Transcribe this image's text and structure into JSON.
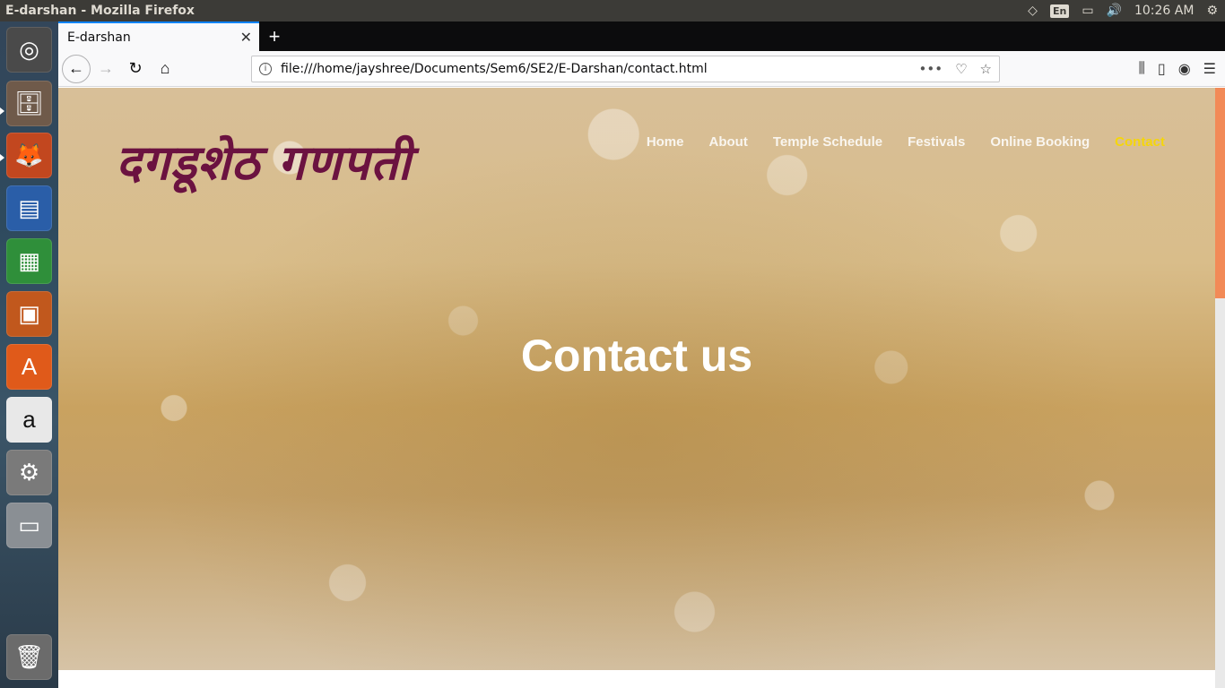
{
  "os": {
    "window_title": "E-darshan - Mozilla Firefox",
    "lang": "En",
    "time": "10:26 AM"
  },
  "launcher": {
    "items": [
      {
        "name": "ubuntu-dash-icon",
        "glyph": "◎",
        "bg": "#4a4a4a"
      },
      {
        "name": "files-icon",
        "glyph": "🗄",
        "bg": "#6f5a4a"
      },
      {
        "name": "firefox-icon",
        "glyph": "🦊",
        "bg": "#c2471f"
      },
      {
        "name": "writer-icon",
        "glyph": "▤",
        "bg": "#2a5ea8"
      },
      {
        "name": "calc-icon",
        "glyph": "▦",
        "bg": "#2f8f3a"
      },
      {
        "name": "impress-icon",
        "glyph": "▣",
        "bg": "#c1581d"
      },
      {
        "name": "software-center-icon",
        "glyph": "A",
        "bg": "#e05a1a"
      },
      {
        "name": "amazon-icon",
        "glyph": "a",
        "bg": "#e8e8e8"
      },
      {
        "name": "settings-icon",
        "glyph": "⚙",
        "bg": "#7a7a7a"
      },
      {
        "name": "disk-icon",
        "glyph": "▭",
        "bg": "#8a8f94"
      },
      {
        "name": "trash-icon",
        "glyph": "🗑",
        "bg": "#6b6b6b"
      }
    ]
  },
  "browser": {
    "tab_title": "E-darshan",
    "url": "file:///home/jayshree/Documents/Sem6/SE2/E-Darshan/contact.html"
  },
  "site": {
    "logo_text": "दगडूशेठ गणपती",
    "nav": {
      "home": "Home",
      "about": "About",
      "schedule": "Temple Schedule",
      "festivals": "Festivals",
      "booking": "Online Booking",
      "contact": "Contact"
    },
    "hero_title": "Contact us",
    "active_color": "#f5d60a"
  }
}
